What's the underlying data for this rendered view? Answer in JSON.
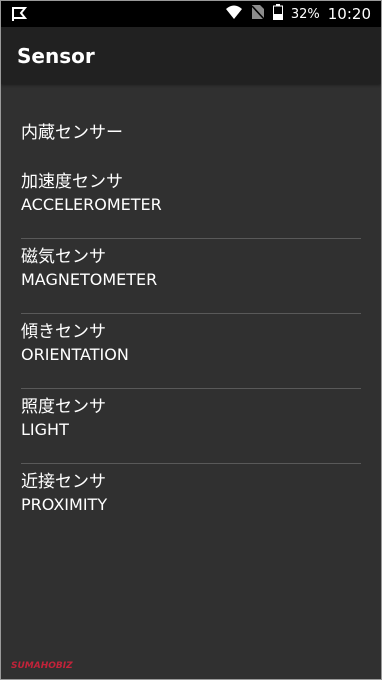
{
  "status_bar": {
    "battery_percent": "32%",
    "time": "10:20",
    "icons": [
      "notification-flag-icon",
      "wifi-icon",
      "no-sim-icon",
      "battery-icon"
    ]
  },
  "app_bar": {
    "title": "Sensor"
  },
  "list": {
    "header": "内蔵センサー",
    "items": [
      {
        "jp": "加速度センサ",
        "en": "ACCELEROMETER"
      },
      {
        "jp": "磁気センサ",
        "en": "MAGNETOMETER"
      },
      {
        "jp": "傾きセンサ",
        "en": "ORIENTATION"
      },
      {
        "jp": "照度センサ",
        "en": "LIGHT"
      },
      {
        "jp": "近接センサ",
        "en": "PROXIMITY"
      }
    ]
  },
  "watermark": "SUMAHOBIZ",
  "colors": {
    "status_bar": "#000000",
    "app_bar": "#212121",
    "background": "#303030",
    "divider": "#595959",
    "watermark": "#c2233a"
  }
}
